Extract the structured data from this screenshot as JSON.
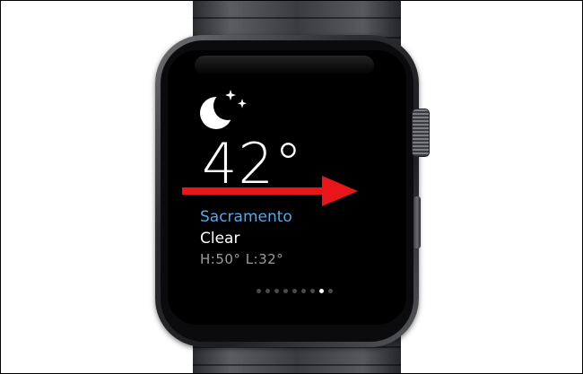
{
  "weather": {
    "condition_icon": "moon-stars-icon",
    "temperature": "42°",
    "city": "Sacramento",
    "condition": "Clear",
    "high_low": "H:50° L:32°"
  },
  "page_indicator": {
    "total_pages": 9,
    "active_page": 8
  },
  "annotation": {
    "arrow_icon": "swipe-right-arrow-icon",
    "arrow_color": "#e8151b"
  },
  "colors": {
    "city_accent": "#5aa7e6",
    "screen_background": "#000000",
    "secondary_text": "#9c9ca0"
  }
}
